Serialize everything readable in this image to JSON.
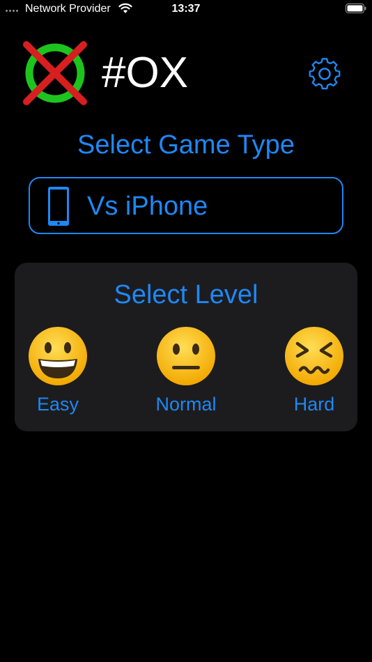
{
  "status_bar": {
    "carrier": "Network Provider",
    "time": "13:37",
    "icons": [
      "signal-dots-icon",
      "wifi-icon",
      "battery-icon"
    ]
  },
  "header": {
    "logo": "ox-logo-icon",
    "title": "#OX",
    "settings_icon": "gear-icon"
  },
  "game_type": {
    "section_title": "Select Game Type",
    "selected_label": "Vs iPhone",
    "icon": "iphone-icon"
  },
  "level": {
    "section_title": "Select Level",
    "options": [
      {
        "label": "Easy",
        "icon": "grinning-face-icon"
      },
      {
        "label": "Normal",
        "icon": "neutral-face-icon"
      },
      {
        "label": "Hard",
        "icon": "confounded-face-icon"
      }
    ]
  },
  "colors": {
    "background": "#000000",
    "accent": "#1e88f5",
    "panel": "#1c1c1e",
    "logo_ring": "#1ec41e",
    "logo_cross": "#d71f1f",
    "emoji_yellow": "#fcc21b"
  }
}
